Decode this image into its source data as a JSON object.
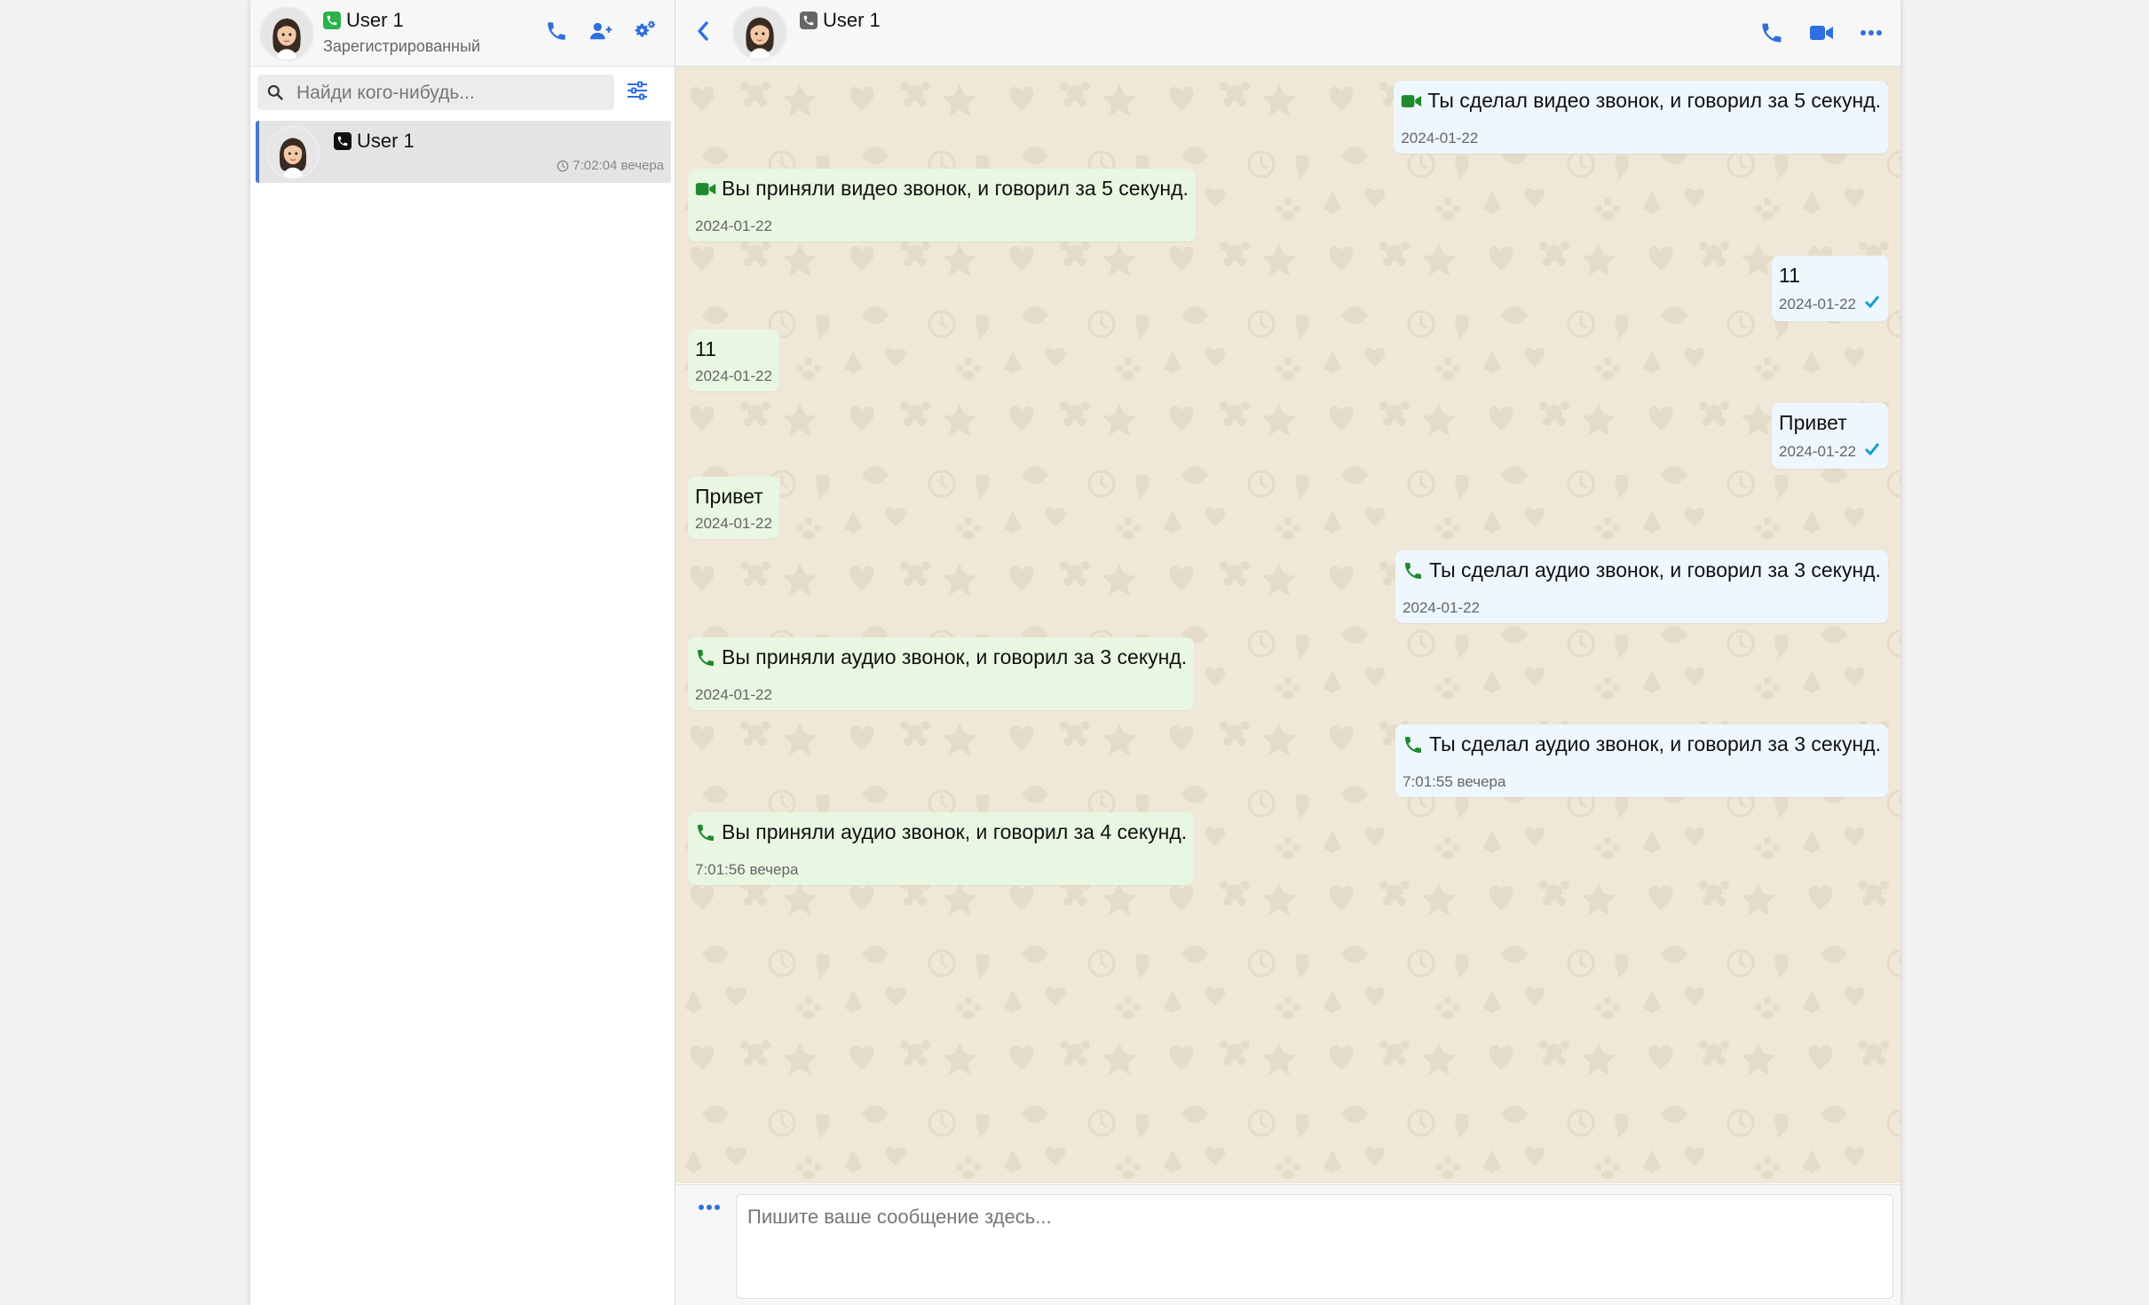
{
  "sidebar": {
    "user_name": "User 1",
    "user_status": "Зарегистрированный",
    "search_placeholder": "Найди кого-нибудь...",
    "contacts": [
      {
        "name": "User 1",
        "time": "7:02:04 вечера"
      }
    ]
  },
  "chat": {
    "contact_name": "User 1",
    "composer_placeholder": "Пишите ваше сообщение здесь...",
    "messages": [
      {
        "dir": "out",
        "icon": "video",
        "text": "Ты сделал видео звонок, и говорил за 5 секунд.",
        "time": "2024-01-22"
      },
      {
        "dir": "in",
        "icon": "video",
        "text": "Вы приняли видео звонок, и говорил за 5 секунд.",
        "time": "2024-01-22"
      },
      {
        "dir": "out",
        "icon": "",
        "text": "11",
        "time": "2024-01-22",
        "read": true
      },
      {
        "dir": "in",
        "icon": "",
        "text": "11",
        "time": "2024-01-22"
      },
      {
        "dir": "out",
        "icon": "",
        "text": "Привет",
        "time": "2024-01-22",
        "read": true
      },
      {
        "dir": "in",
        "icon": "",
        "text": "Привет",
        "time": "2024-01-22"
      },
      {
        "dir": "out",
        "icon": "phone",
        "text": "Ты сделал аудио звонок, и говорил за 3 секунд.",
        "time": "2024-01-22"
      },
      {
        "dir": "in",
        "icon": "phone",
        "text": "Вы приняли аудио звонок, и говорил за 3 секунд.",
        "time": "2024-01-22"
      },
      {
        "dir": "out",
        "icon": "phone",
        "text": "Ты сделал аудио звонок, и говорил за 3 секунд.",
        "time": "7:01:55 вечера"
      },
      {
        "dir": "in",
        "icon": "phone",
        "text": "Вы приняли аудио звонок, и говорил за 4 секунд.",
        "time": "7:01:56 вечера"
      }
    ]
  },
  "colors": {
    "accent": "#2f6fe0",
    "call_icon_green": "#1e8a2c",
    "chat_background": "#efe7d8",
    "outgoing_bubble": "#eef6fe",
    "incoming_bubble": "#e9f6e2",
    "read_check": "#1a9ec9"
  }
}
